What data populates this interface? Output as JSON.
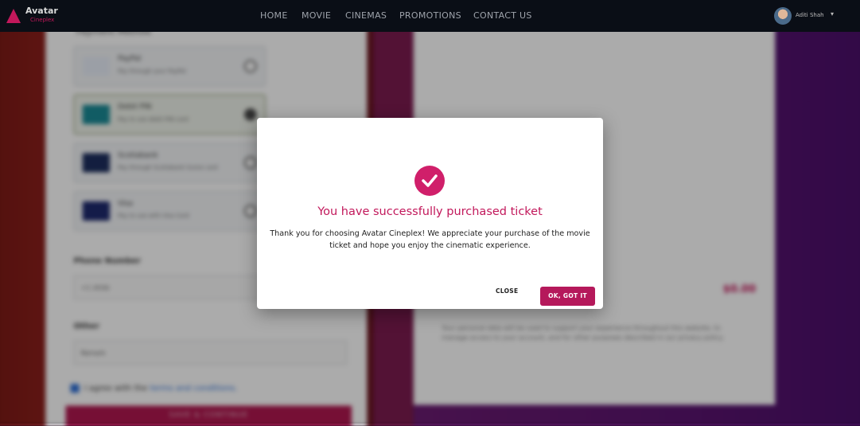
{
  "brand": {
    "name": "Avatar",
    "tagline": "Cineplex",
    "accent": "#c2185b"
  },
  "nav": {
    "items": [
      "HOME",
      "MOVIE",
      "CINEMAS",
      "PROMOTIONS",
      "CONTACT US"
    ],
    "user_name": "Aditi Shah"
  },
  "checkout": {
    "payment_label": "Payment Method",
    "options": [
      {
        "title": "PayPal",
        "desc": "Pay through your PayPal",
        "selected": false
      },
      {
        "title": "Debit PIN",
        "desc": "Pay to use debit PIN card",
        "selected": true
      },
      {
        "title": "Scotiabank",
        "desc": "Pay through Scotiabank Scene card",
        "selected": false
      },
      {
        "title": "Visa",
        "desc": "Pay to use with Visa Card",
        "selected": false
      }
    ],
    "phone_label": "Phone Number",
    "phone_value": "+1 (416)",
    "other_label": "Other",
    "other_value": "Remark",
    "agree_text": "I agree with the",
    "agree_link": "terms and conditions.",
    "save_button": "SAVE & CONTINUE"
  },
  "summary": {
    "total_value": "$0.00",
    "policy_text": "Your personal data will be used to support your experience throughout this website, to manage access to your account, and for other purposes described in our privacy policy."
  },
  "modal": {
    "title": "You have successfully purchased ticket",
    "body": "Thank you for choosing Avatar Cineplex! We appreciate your purchase of the movie ticket and hope you enjoy the cinematic experience.",
    "close_label": "CLOSE",
    "ok_label": "OK, GOT IT"
  }
}
